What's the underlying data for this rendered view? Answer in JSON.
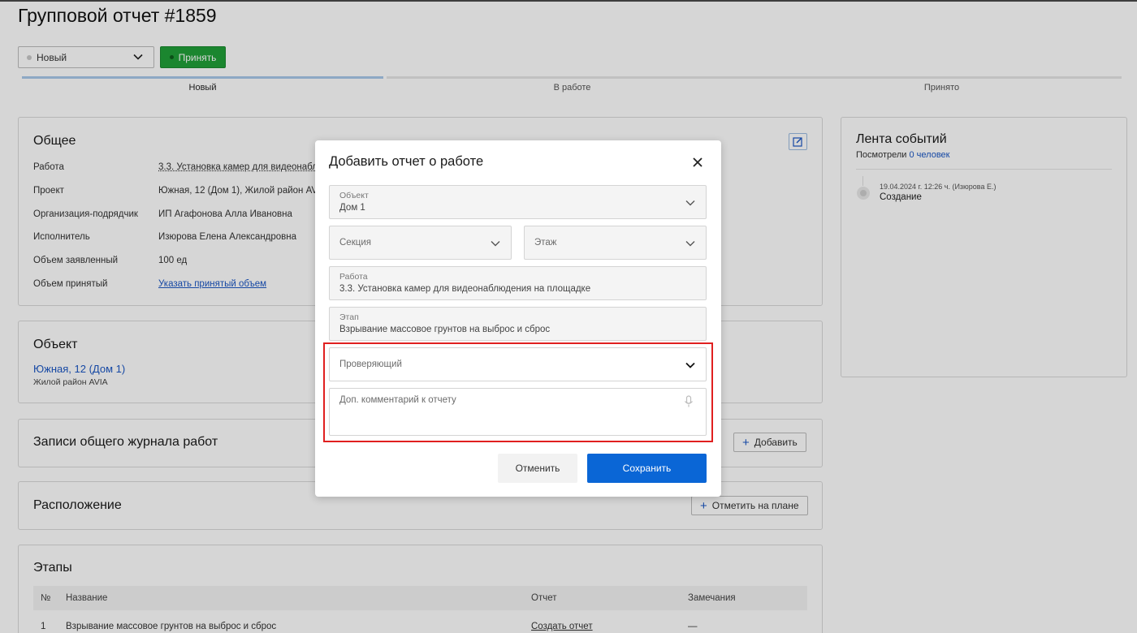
{
  "page": {
    "title": "Групповой отчет #1859",
    "status_select": "Новый",
    "accept_button": "Принять",
    "steps": [
      "Новый",
      "В работе",
      "Принято"
    ]
  },
  "general": {
    "title": "Общее",
    "rows": [
      {
        "label": "Работа",
        "value": "3.3. Установка камер для видеонабл"
      },
      {
        "label": "Проект",
        "value": "Южная, 12 (Дом 1), Жилой район AVI"
      },
      {
        "label": "Организация-подрядчик",
        "value": "ИП Агафонова Алла Ивановна"
      },
      {
        "label": "Исполнитель",
        "value": "Изюрова Елена Александровна"
      },
      {
        "label": "Объем заявленный",
        "value": "100 ед"
      },
      {
        "label": "Объем принятый",
        "value": "Указать принятый объем"
      }
    ]
  },
  "object": {
    "title": "Объект",
    "link": "Южная, 12 (Дом 1)",
    "subtitle": "Жилой район AVIA"
  },
  "journal": {
    "title": "Записи общего журнала работ",
    "add_button": "Добавить"
  },
  "location": {
    "title": "Расположение",
    "plan_button": "Отметить на плане"
  },
  "stages": {
    "title": "Этапы",
    "columns": [
      "№",
      "Название",
      "Отчет",
      "Замечания"
    ],
    "rows": [
      {
        "num": "1",
        "name": "Взрывание массовое грунтов на выброс и сброс",
        "report": "Создать отчет",
        "remarks": "—"
      }
    ]
  },
  "feed": {
    "title": "Лента событий",
    "viewed_prefix": "Посмотрели",
    "viewed_link": "0 человек",
    "events": [
      {
        "time": "19.04.2024 г. 12:26 ч. (Изюрова Е.)",
        "text": "Создание"
      }
    ]
  },
  "modal": {
    "title": "Добавить отчет о работе",
    "object_label": "Объект",
    "object_value": "Дом 1",
    "section_placeholder": "Секция",
    "floor_placeholder": "Этаж",
    "work_label": "Работа",
    "work_value": "3.3. Установка камер для видеонаблюдения на площадке",
    "stage_label": "Этап",
    "stage_value": "Взрывание массовое грунтов на выброс и сброс",
    "reviewer_placeholder": "Проверяющий",
    "comment_placeholder": "Доп. комментарий к отчету",
    "cancel_button": "Отменить",
    "save_button": "Сохранить"
  },
  "colors": {
    "accent_blue": "#0a66d6",
    "accept_green": "#21a038",
    "highlight_red": "#e02020",
    "link_blue": "#1a56c4"
  }
}
